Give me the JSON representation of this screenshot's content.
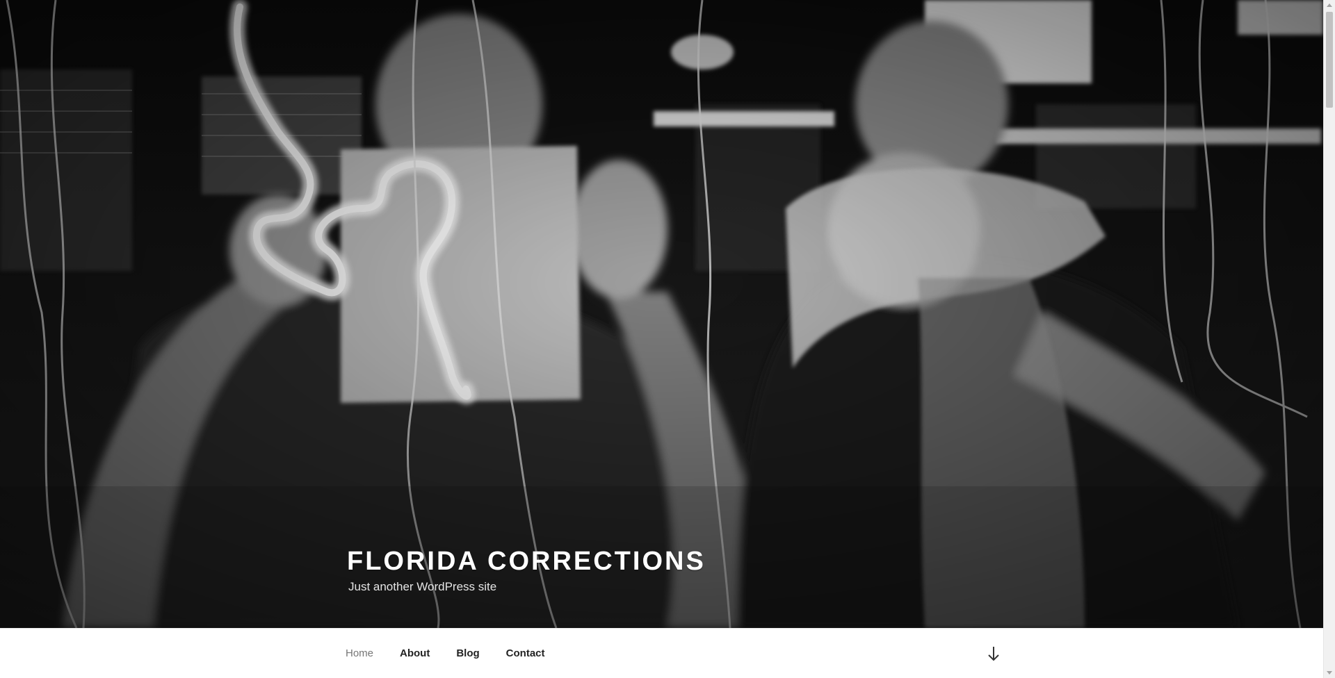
{
  "site": {
    "title": "FLORIDA CORRECTIONS",
    "description": "Just another WordPress site"
  },
  "nav": {
    "items": [
      {
        "label": "Home",
        "current": true
      },
      {
        "label": "About",
        "current": false
      },
      {
        "label": "Blog",
        "current": false
      },
      {
        "label": "Contact",
        "current": false
      }
    ],
    "scroll_icon": "arrow-down-icon"
  },
  "header_image": {
    "style": "black-and-white photo",
    "icon": "header-photo"
  },
  "colors": {
    "title": "#ffffff",
    "nav_text": "#222222",
    "nav_current": "#767676",
    "background": "#ffffff"
  }
}
